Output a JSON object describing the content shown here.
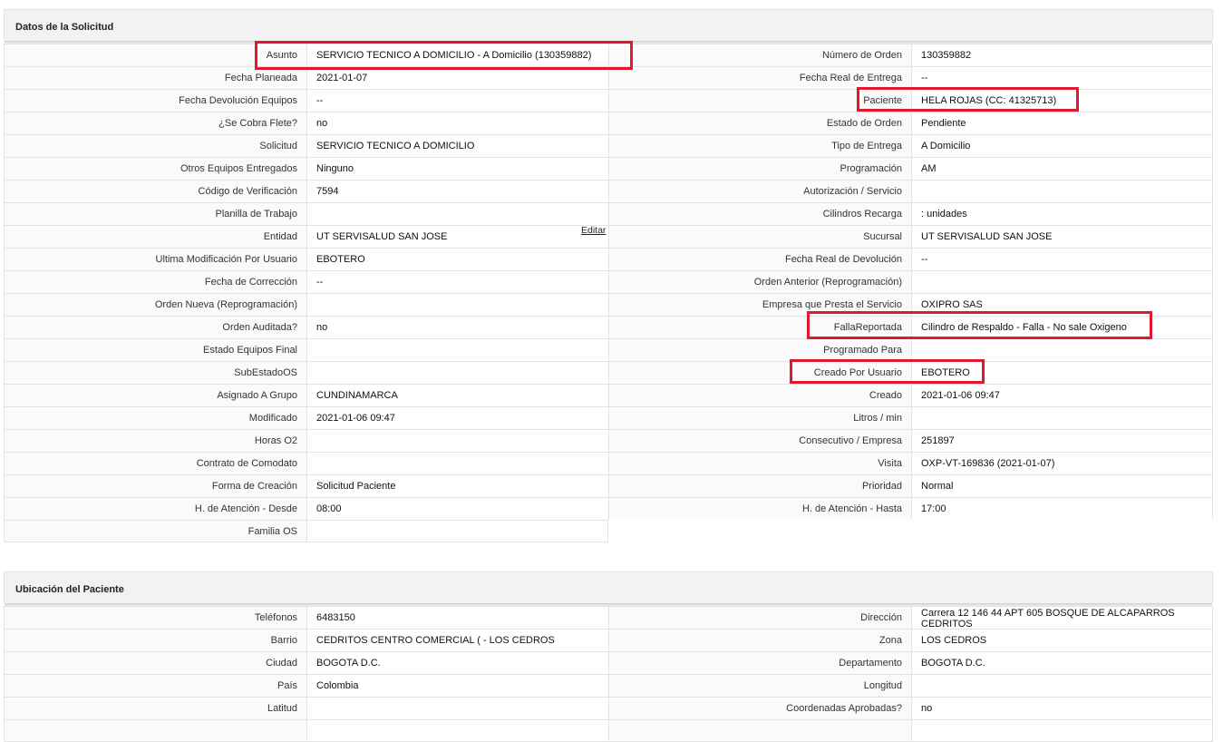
{
  "solicitud": {
    "title": "Datos de la Solicitud",
    "edit_label": "Editar",
    "rows": [
      {
        "ll": "Asunto",
        "lv": "SERVICIO TECNICO A DOMICILIO - A Domicilio (130359882)",
        "rl": "Número de Orden",
        "rv": "130359882"
      },
      {
        "ll": "Fecha Planeada",
        "lv": "2021-01-07",
        "rl": "Fecha Real de Entrega",
        "rv": "--"
      },
      {
        "ll": "Fecha Devolución Equipos",
        "lv": "--",
        "rl": "Paciente",
        "rv": "HELA ROJAS (CC: 41325713)"
      },
      {
        "ll": "¿Se Cobra Flete?",
        "lv": "no",
        "rl": "Estado de Orden",
        "rv": "Pendiente"
      },
      {
        "ll": "Solicitud",
        "lv": "SERVICIO TECNICO A DOMICILIO",
        "rl": "Tipo de Entrega",
        "rv": "A Domicilio"
      },
      {
        "ll": "Otros Equipos Entregados",
        "lv": "Ninguno",
        "rl": "Programación",
        "rv": "AM"
      },
      {
        "ll": "Código de Verificación",
        "lv": "7594",
        "rl": "Autorización / Servicio",
        "rv": ""
      },
      {
        "ll": "Planilla de Trabajo",
        "lv": "",
        "rl": "Cilindros Recarga",
        "rv": ": unidades"
      },
      {
        "ll": "Entidad",
        "lv": "UT SERVISALUD SAN JOSE",
        "rl": "Sucursal",
        "rv": "UT SERVISALUD SAN JOSE"
      },
      {
        "ll": "Ultima Modificación Por Usuario",
        "lv": "EBOTERO",
        "rl": "Fecha Real de Devolución",
        "rv": "--"
      },
      {
        "ll": "Fecha de Corrección",
        "lv": "--",
        "rl": "Orden Anterior (Reprogramación)",
        "rv": ""
      },
      {
        "ll": "Orden Nueva (Reprogramación)",
        "lv": "",
        "rl": "Empresa que Presta el Servicio",
        "rv": "OXIPRO SAS"
      },
      {
        "ll": "Orden Auditada?",
        "lv": "no",
        "rl": "FallaReportada",
        "rv": "Cilindro de Respaldo - Falla - No sale Oxigeno"
      },
      {
        "ll": "Estado Equipos Final",
        "lv": "",
        "rl": "Programado Para",
        "rv": ""
      },
      {
        "ll": "SubEstadoOS",
        "lv": "",
        "rl": "Creado Por Usuario",
        "rv": "EBOTERO"
      },
      {
        "ll": "Asignado A Grupo",
        "lv": "CUNDINAMARCA",
        "rl": "Creado",
        "rv": "2021-01-06 09:47"
      },
      {
        "ll": "Modificado",
        "lv": "2021-01-06 09:47",
        "rl": "Litros / min",
        "rv": ""
      },
      {
        "ll": "Horas O2",
        "lv": "",
        "rl": "Consecutivo / Empresa",
        "rv": "251897"
      },
      {
        "ll": "Contrato de Comodato",
        "lv": "",
        "rl": "Visita",
        "rv": "OXP-VT-169836 (2021-01-07)"
      },
      {
        "ll": "Forma de Creación",
        "lv": "Solicitud Paciente",
        "rl": "Prioridad",
        "rv": "Normal"
      },
      {
        "ll": "H. de Atención - Desde",
        "lv": "08:00",
        "rl": "H. de Atención - Hasta",
        "rv": "17:00"
      },
      {
        "ll": "Familia OS",
        "lv": "",
        "rl": null,
        "rv": null
      }
    ]
  },
  "ubicacion": {
    "title": "Ubicación del Paciente",
    "rows": [
      {
        "ll": "Teléfonos",
        "lv": "6483150",
        "rl": "Dirección",
        "rv": "Carrera 12 146 44 APT 605 BOSQUE DE ALCAPARROS CEDRITOS"
      },
      {
        "ll": "Barrio",
        "lv": "CEDRITOS CENTRO COMERCIAL ( - LOS CEDROS",
        "rl": "Zona",
        "rv": "LOS CEDROS"
      },
      {
        "ll": "Ciudad",
        "lv": "BOGOTA D.C.",
        "rl": "Departamento",
        "rv": "BOGOTA D.C."
      },
      {
        "ll": "País",
        "lv": "Colombia",
        "rl": "Longitud",
        "rv": ""
      },
      {
        "ll": "Latitud",
        "lv": "",
        "rl": "Coordenadas Aprobadas?",
        "rv": "no"
      },
      {
        "ll": "",
        "lv": "",
        "rl": "",
        "rv": ""
      }
    ]
  }
}
